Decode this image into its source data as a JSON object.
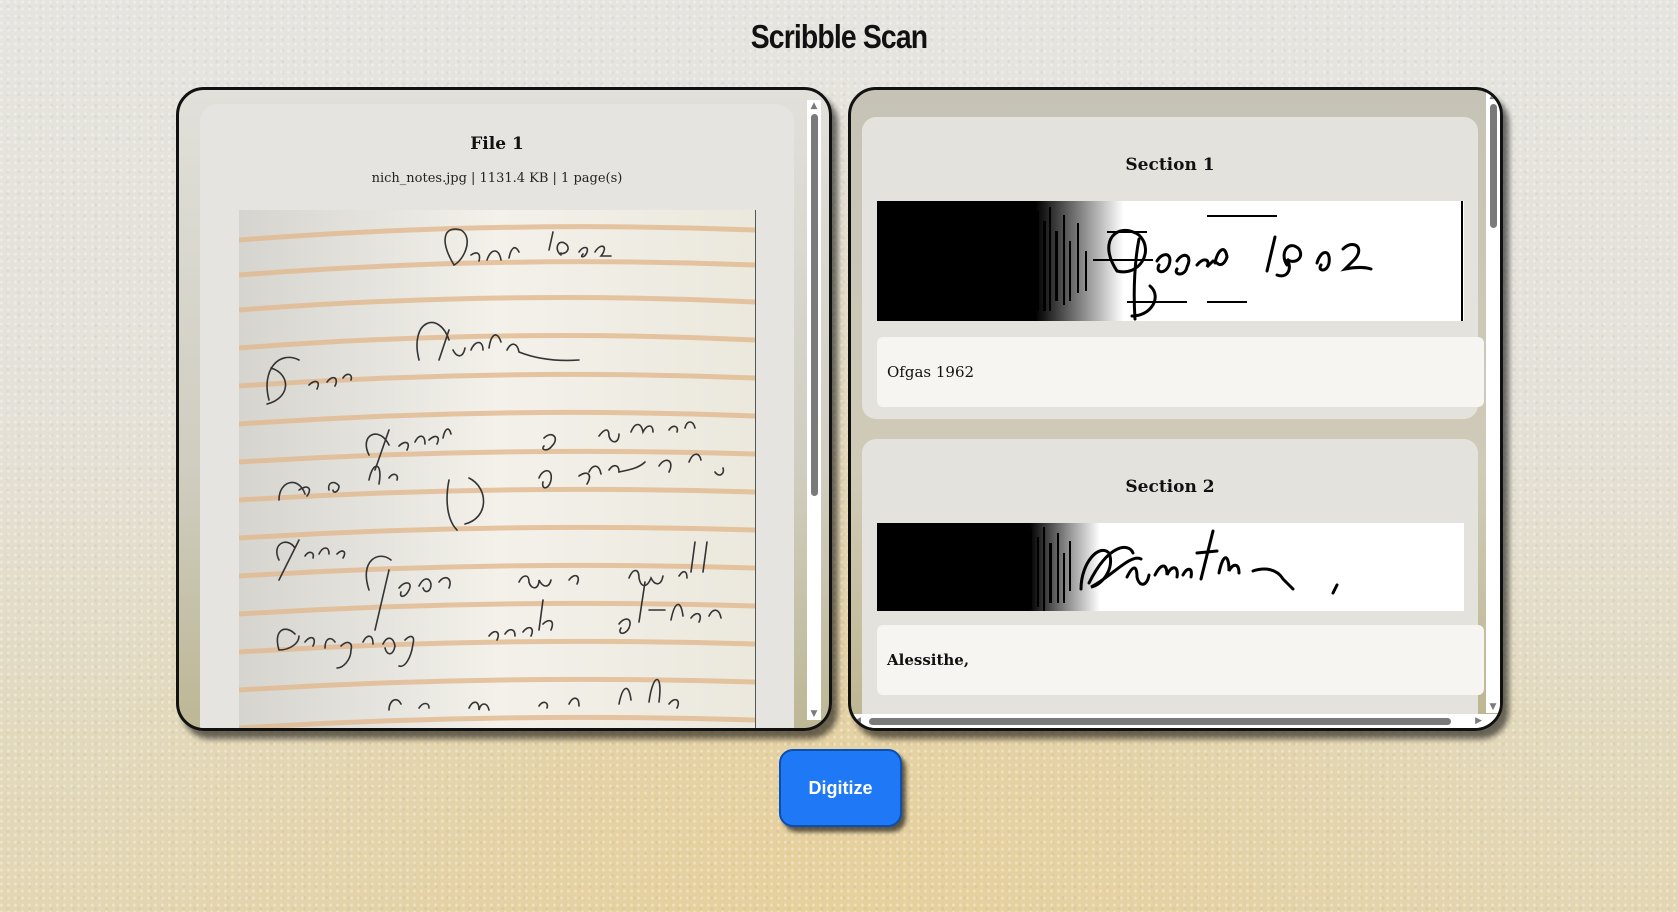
{
  "app": {
    "title": "Scribble Scan"
  },
  "file_panel": {
    "file": {
      "title": "File 1",
      "meta": "nich_notes.jpg | 1131.4 KB | 1 page(s)"
    }
  },
  "sections_panel": {
    "sections": [
      {
        "title": "Section 1",
        "text": "Ofgas 1962"
      },
      {
        "title": "Section 2",
        "text": "Alessithe,"
      }
    ]
  },
  "actions": {
    "digitize_label": "Digitize"
  }
}
